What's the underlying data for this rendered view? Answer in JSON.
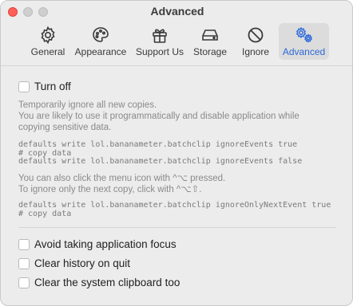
{
  "window": {
    "title": "Advanced",
    "colors": {
      "close": "#ff5f57",
      "accent": "#2b6ad9"
    }
  },
  "toolbar": {
    "tabs": [
      {
        "label": "General",
        "icon": "gear-icon",
        "active": false
      },
      {
        "label": "Appearance",
        "icon": "palette-icon",
        "active": false
      },
      {
        "label": "Support Us",
        "icon": "gift-icon",
        "active": false
      },
      {
        "label": "Storage",
        "icon": "storage-drive-icon",
        "active": false
      },
      {
        "label": "Ignore",
        "icon": "prohibited-icon",
        "active": false
      },
      {
        "label": "Advanced",
        "icon": "gears-icon",
        "active": true
      }
    ]
  },
  "content": {
    "turn_off_label": "Turn off",
    "description_lines": [
      "Temporarily ignore all new copies.",
      "You are likely to use it programmatically and disable application while",
      "copying sensitive data."
    ],
    "code_block_1": [
      "defaults write lol.bananameter.batchclip ignoreEvents true",
      "# copy data",
      "defaults write lol.bananameter.batchclip ignoreEvents false"
    ],
    "menu_hint_lines": [
      "You can also click the menu icon with ^⌥ pressed.",
      "To ignore only the next copy, click with ^⌥⇧."
    ],
    "code_block_2": [
      "defaults write lol.bananameter.batchclip ignoreOnlyNextEvent true",
      "# copy data"
    ],
    "options": [
      {
        "label": "Avoid taking application focus",
        "checked": false
      },
      {
        "label": "Clear history on quit",
        "checked": false
      },
      {
        "label": "Clear the system clipboard too",
        "checked": false
      }
    ],
    "turn_off_checked": false
  }
}
